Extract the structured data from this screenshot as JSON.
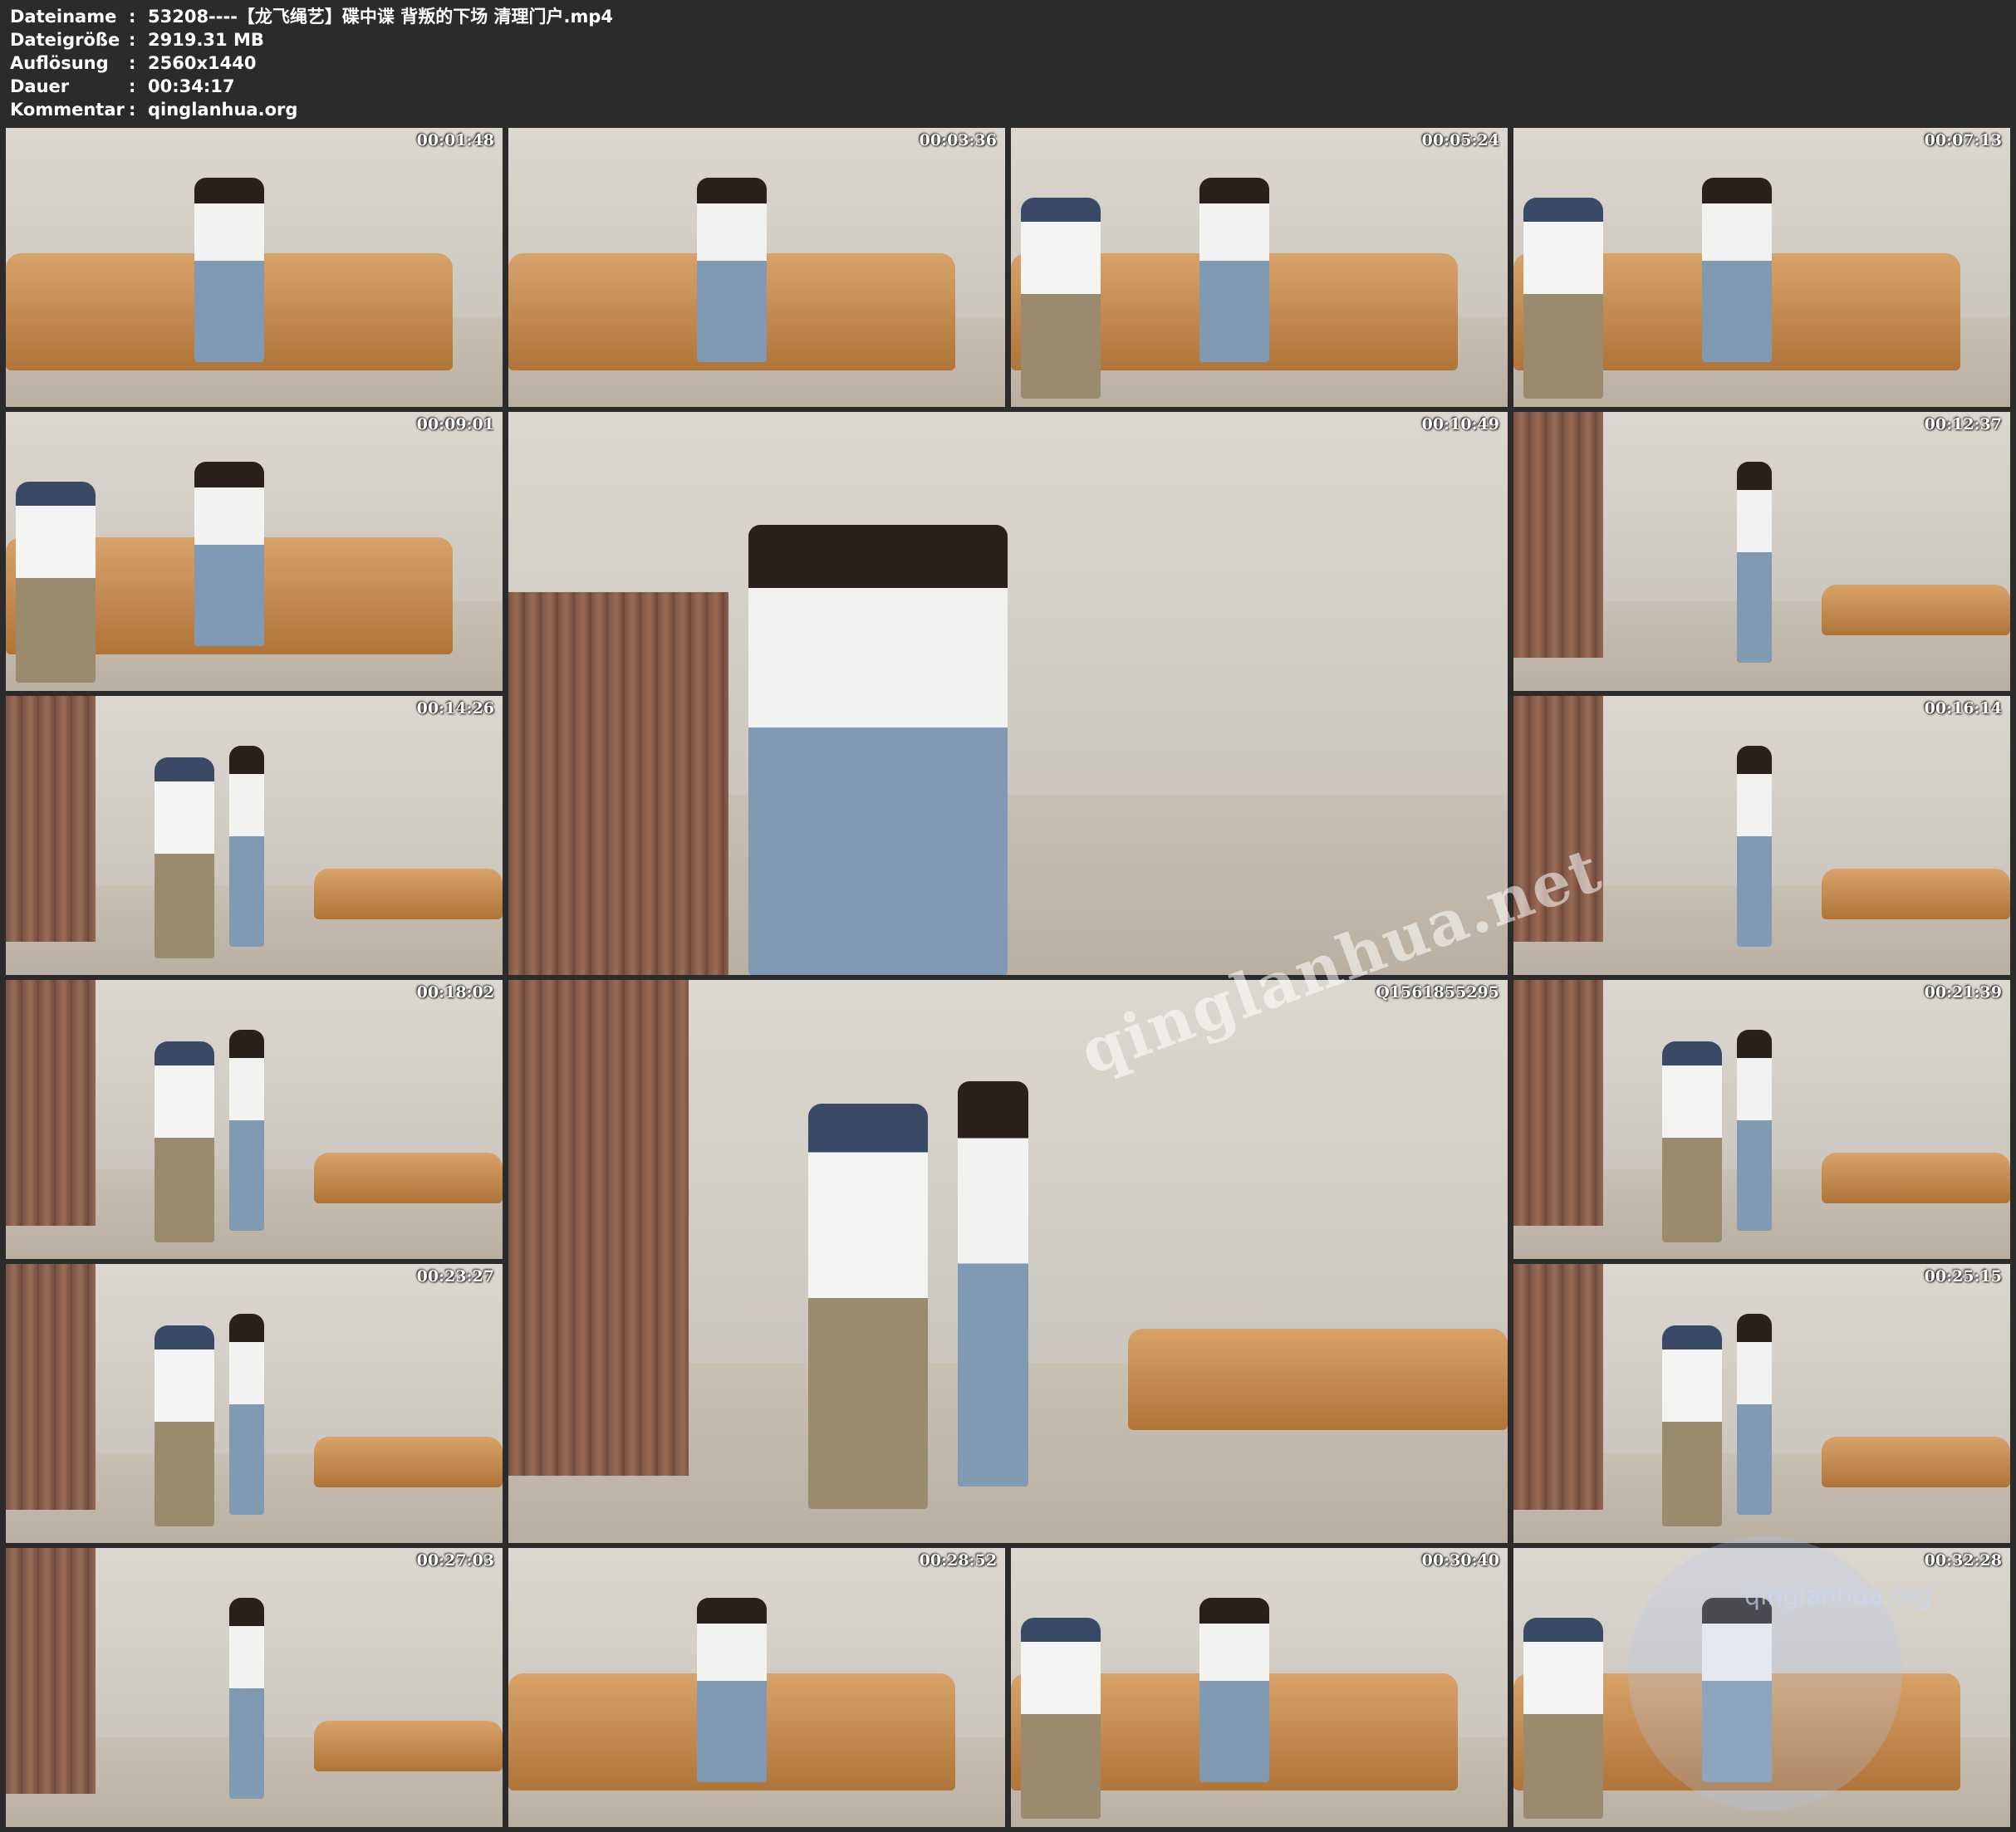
{
  "info": {
    "filename_label": "Dateiname",
    "filename_value": "53208----【龙飞绳艺】碟中谍 背叛的下场 清理门户.mp4",
    "filesize_label": "Dateigröße",
    "filesize_value": "2919.31 MB",
    "resolution_label": "Auflösung",
    "resolution_value": "2560x1440",
    "duration_label": "Dauer",
    "duration_value": "00:34:17",
    "comment_label": "Kommentar",
    "comment_value": "qinglanhua.org",
    "separator": ":"
  },
  "thumbnails": [
    {
      "timestamp": "00:01:48",
      "scene": "sofa"
    },
    {
      "timestamp": "00:03:36",
      "scene": "sofa"
    },
    {
      "timestamp": "00:05:24",
      "scene": "sofa2"
    },
    {
      "timestamp": "00:07:13",
      "scene": "sofa2"
    },
    {
      "timestamp": "00:09:01",
      "scene": "sofa2"
    },
    {
      "timestamp": "00:10:49",
      "scene": "closeup"
    },
    {
      "timestamp": "00:12:37",
      "scene": "room"
    },
    {
      "timestamp": "00:14:26",
      "scene": "room2"
    },
    {
      "timestamp": "00:16:14",
      "scene": "room"
    },
    {
      "timestamp": "00:18:02",
      "scene": "room2"
    },
    {
      "timestamp": "Q1561855295",
      "scene": "room2"
    },
    {
      "timestamp": "00:21:39",
      "scene": "room2"
    },
    {
      "timestamp": "00:23:27",
      "scene": "room2"
    },
    {
      "timestamp": "00:25:15",
      "scene": "room2"
    },
    {
      "timestamp": "00:27:03",
      "scene": "room"
    },
    {
      "timestamp": "00:28:52",
      "scene": "sofa"
    },
    {
      "timestamp": "00:30:40",
      "scene": "sofa2"
    },
    {
      "timestamp": "00:32:28",
      "scene": "sofa2"
    }
  ],
  "watermark": "qinglanhua.net",
  "logo_text": "qinglanhua.org"
}
